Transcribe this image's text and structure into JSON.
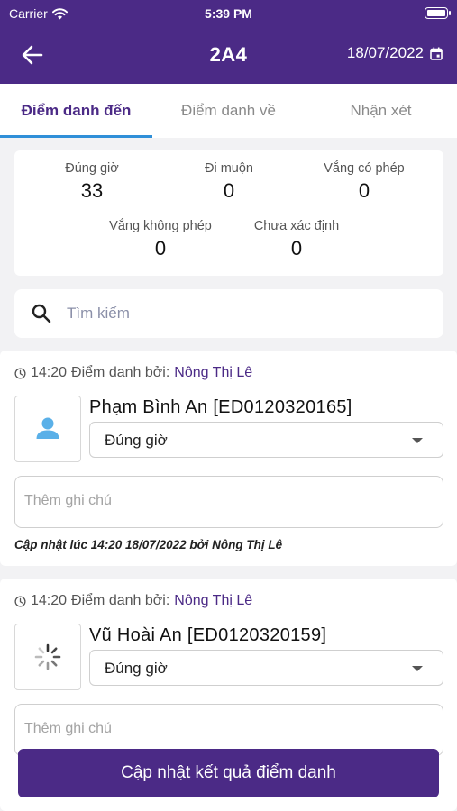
{
  "status_bar": {
    "carrier": "Carrier",
    "time": "5:39 PM"
  },
  "nav": {
    "title": "2A4",
    "date": "18/07/2022"
  },
  "tabs": [
    {
      "label": "Điểm danh đến",
      "active": true
    },
    {
      "label": "Điểm danh về",
      "active": false
    },
    {
      "label": "Nhận xét",
      "active": false
    }
  ],
  "stats": [
    {
      "label": "Đúng giờ",
      "value": "33"
    },
    {
      "label": "Đi muộn",
      "value": "0"
    },
    {
      "label": "Vắng có phép",
      "value": "0"
    },
    {
      "label": "Vắng không phép",
      "value": "0"
    },
    {
      "label": "Chưa xác định",
      "value": "0"
    }
  ],
  "search": {
    "placeholder": "Tìm kiếm"
  },
  "students": [
    {
      "time": "14:20",
      "checked_by_label": "Điểm danh bởi:",
      "teacher": "Nông Thị Lê",
      "name": "Phạm Bình An [ED0120320165]",
      "status": "Đúng giờ",
      "note_placeholder": "Thêm ghi chú",
      "updated": "Cập nhật lúc 14:20 18/07/2022 bởi Nông Thị Lê",
      "avatar_icon": "person-icon"
    },
    {
      "time": "14:20",
      "checked_by_label": "Điểm danh bởi:",
      "teacher": "Nông Thị Lê",
      "name": "Vũ Hoài An [ED0120320159]",
      "status": "Đúng giờ",
      "note_placeholder": "Thêm ghi chú",
      "avatar_icon": "loading-spinner-icon"
    }
  ],
  "submit_label": "Cập nhật kết quả điểm danh",
  "colors": {
    "primary": "#4b2a86",
    "tab_indicator": "#2f8fd8",
    "avatar_blue": "#5ab0e8",
    "background": "#f2f2f4"
  }
}
